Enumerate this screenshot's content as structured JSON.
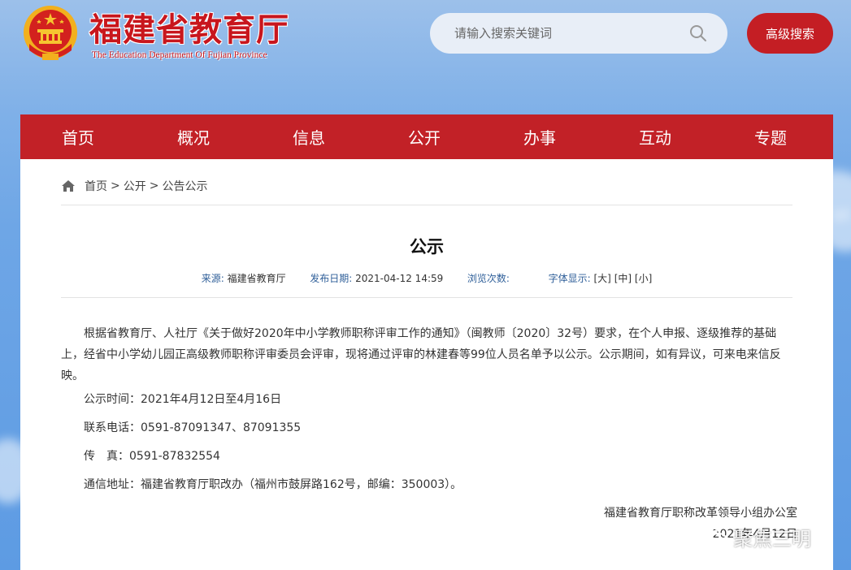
{
  "header": {
    "title": "福建省教育厅",
    "subtitle": "The Education Department Of Fujian Province",
    "search_placeholder": "请输入搜索关键词",
    "advanced_search_label": "高级搜索"
  },
  "nav": {
    "items": [
      "首页",
      "概况",
      "信息",
      "公开",
      "办事",
      "互动",
      "专题"
    ]
  },
  "breadcrumb": {
    "home": "首页",
    "separator": ">",
    "level2": "公开",
    "level3": "公告公示"
  },
  "article": {
    "title": "公示",
    "source_label": "来源:",
    "source_value": "福建省教育厅",
    "date_label": "发布日期:",
    "date_value": "2021-04-12 14:59",
    "views_label": "浏览次数:",
    "font_label": "字体显示:",
    "font_large": "[大]",
    "font_medium": "[中]",
    "font_small": "[小]",
    "paragraph": "根据省教育厅、人社厅《关于做好2020年中小学教师职称评审工作的通知》（闽教师〔2020〕32号）要求，在个人申报、逐级推荐的基础上，经省中小学幼儿园正高级教师职称评审委员会评审，现将通过评审的林建春等99位人员名单予以公示。公示期间，如有异议，可来电来信反映。",
    "period": "公示时间：2021年4月12日至4月16日",
    "phone": "联系电话：0591-87091347、87091355",
    "fax": "传　真：0591-87832554",
    "address": "通信地址：福建省教育厅职改办（福州市鼓屏路162号，邮编：350003）。",
    "signature": "福建省教育厅职称改革领导小组办公室",
    "sign_date": "2021年4月12日"
  },
  "watermark": {
    "text": "聚焦三明"
  },
  "colors": {
    "brand_red": "#c22127",
    "title_red": "#c8161d",
    "meta_blue": "#2f5f99"
  }
}
